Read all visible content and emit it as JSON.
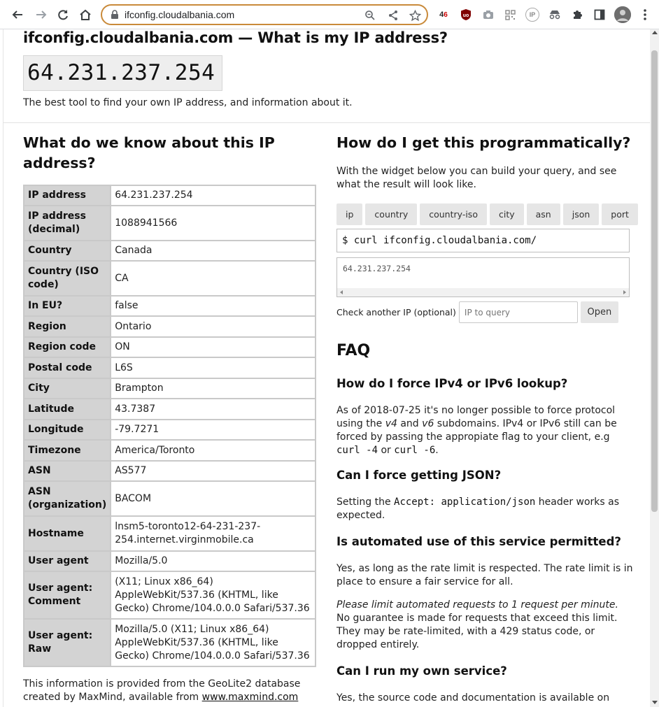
{
  "browser": {
    "url": "ifconfig.cloudalbania.com",
    "extensions": [
      "4g-extension-icon",
      "ublock-icon",
      "camera-icon",
      "qr-icon",
      "ip-icon",
      "incognito-icon",
      "puzzle-icon",
      "sidebar-icon"
    ],
    "ext_4g_label": "4",
    "ext_ip_label": "IP"
  },
  "page": {
    "title": "ifconfig.cloudalbania.com — What is my IP address?",
    "ip": "64.231.237.254",
    "tagline": "The best tool to find your own IP address, and information about it."
  },
  "left": {
    "heading": "What do we know about this IP address?",
    "rows": [
      {
        "key": "IP address",
        "value": "64.231.237.254"
      },
      {
        "key": "IP address (decimal)",
        "value": "1088941566"
      },
      {
        "key": "Country",
        "value": "Canada"
      },
      {
        "key": "Country (ISO code)",
        "value": "CA"
      },
      {
        "key": "In EU?",
        "value": "false"
      },
      {
        "key": "Region",
        "value": "Ontario"
      },
      {
        "key": "Region code",
        "value": "ON"
      },
      {
        "key": "Postal code",
        "value": "L6S"
      },
      {
        "key": "City",
        "value": "Brampton"
      },
      {
        "key": "Latitude",
        "value": "43.7387"
      },
      {
        "key": "Longitude",
        "value": "-79.7271"
      },
      {
        "key": "Timezone",
        "value": "America/Toronto"
      },
      {
        "key": "ASN",
        "value": "AS577"
      },
      {
        "key": "ASN (organization)",
        "value": "BACOM"
      },
      {
        "key": "Hostname",
        "value": "lnsm5-toronto12-64-231-237-254.internet.virginmobile.ca"
      },
      {
        "key": "User agent",
        "value": "Mozilla/5.0"
      },
      {
        "key": "User agent: Comment",
        "value": "(X11; Linux x86_64) AppleWebKit/537.36 (KHTML, like Gecko) Chrome/104.0.0.0 Safari/537.36"
      },
      {
        "key": "User agent: Raw",
        "value": "Mozilla/5.0 (X11; Linux x86_64) AppleWebKit/537.36 (KHTML, like Gecko) Chrome/104.0.0.0 Safari/537.36"
      }
    ],
    "footnote_text": "This information is provided from the GeoLite2 database created by MaxMind, available from ",
    "footnote_link": "www.maxmind.com"
  },
  "right": {
    "heading": "How do I get this programmatically?",
    "intro": "With the widget below you can build your query, and see what the result will look like.",
    "tabs": [
      "ip",
      "country",
      "country-iso",
      "city",
      "asn",
      "json",
      "port"
    ],
    "curl_command": "$ curl ifconfig.cloudalbania.com/",
    "result": "64.231.237.254",
    "check_label": "Check another IP (optional)",
    "check_placeholder": "IP to query",
    "open_label": "Open"
  },
  "faq": {
    "heading": "FAQ",
    "q1": "How do I force IPv4 or IPv6 lookup?",
    "a1_part1": "As of 2018-07-25 it's no longer possible to force protocol using the ",
    "a1_v4": "v4",
    "a1_and": " and ",
    "a1_v6": "v6",
    "a1_part2": " subdomains. IPv4 or IPv6 still can be forced by passing the appropiate flag to your client, e.g ",
    "a1_code1": "curl -4",
    "a1_or": " or ",
    "a1_code2": "curl -6",
    "a1_end": ".",
    "q2": "Can I force getting JSON?",
    "a2_part1": "Setting the ",
    "a2_code": "Accept: application/json",
    "a2_part2": " header works as expected.",
    "q3": "Is automated use of this service permitted?",
    "a3": "Yes, as long as the rate limit is respected. The rate limit is in place to ensure a fair service for all.",
    "a3b_em": "Please limit automated requests to 1 request per minute.",
    "a3b_rest": " No guarantee is made for requests that exceed this limit. They may be rate-limited, with a 429 status code, or dropped entirely.",
    "q4": "Can I run my own service?",
    "a4": "Yes, the source code and documentation is available on"
  }
}
